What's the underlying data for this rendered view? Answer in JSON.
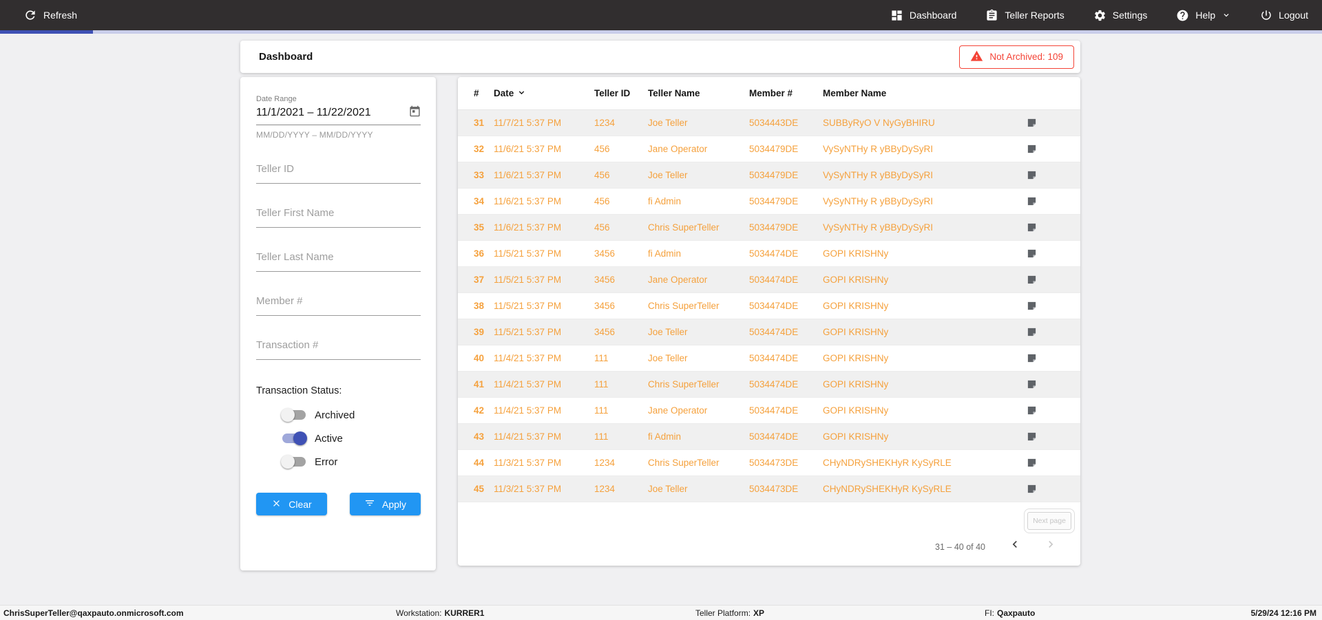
{
  "nav": {
    "refresh_label": "Refresh",
    "items": [
      {
        "label": "Dashboard",
        "icon": "dashboard-grid-icon"
      },
      {
        "label": "Teller Reports",
        "icon": "clipboard-icon"
      },
      {
        "label": "Settings",
        "icon": "gear-icon"
      },
      {
        "label": "Help",
        "icon": "help-circle-icon",
        "has_chevron": true
      },
      {
        "label": "Logout",
        "icon": "power-icon"
      }
    ]
  },
  "header": {
    "title": "Dashboard",
    "not_archived_label": "Not Archived: 109"
  },
  "filters": {
    "date_range": {
      "label": "Date Range",
      "value": "11/1/2021 – 11/22/2021",
      "hint": "MM/DD/YYYY – MM/DD/YYYY",
      "icon": "calendar-icon"
    },
    "inputs": [
      {
        "placeholder": "Teller ID",
        "value": ""
      },
      {
        "placeholder": "Teller First Name",
        "value": ""
      },
      {
        "placeholder": "Teller Last Name",
        "value": ""
      },
      {
        "placeholder": "Member #",
        "value": ""
      },
      {
        "placeholder": "Transaction #",
        "value": ""
      }
    ],
    "status": {
      "label": "Transaction Status:",
      "toggles": [
        {
          "label": "Archived",
          "on": false
        },
        {
          "label": "Active",
          "on": true
        },
        {
          "label": "Error",
          "on": false
        }
      ]
    },
    "clear_label": "Clear",
    "apply_label": "Apply"
  },
  "table": {
    "columns": [
      "#",
      "Date",
      "Teller ID",
      "Teller Name",
      "Member #",
      "Member Name"
    ],
    "sort": {
      "column": "Date",
      "direction": "desc"
    },
    "rows": [
      [
        "31",
        "11/7/21 5:37 PM",
        "1234",
        "Joe Teller",
        "5034443DE",
        "SUBByRyO V NyGyBHIRU"
      ],
      [
        "32",
        "11/6/21 5:37 PM",
        "456",
        "Jane Operator",
        "5034479DE",
        "VySyNTHy R yBByDySyRI"
      ],
      [
        "33",
        "11/6/21 5:37 PM",
        "456",
        "Joe Teller",
        "5034479DE",
        "VySyNTHy R yBByDySyRI"
      ],
      [
        "34",
        "11/6/21 5:37 PM",
        "456",
        "fi Admin",
        "5034479DE",
        "VySyNTHy R yBByDySyRI"
      ],
      [
        "35",
        "11/6/21 5:37 PM",
        "456",
        "Chris SuperTeller",
        "5034479DE",
        "VySyNTHy R yBByDySyRI"
      ],
      [
        "36",
        "11/5/21 5:37 PM",
        "3456",
        "fi Admin",
        "5034474DE",
        "GOPI KRISHNy"
      ],
      [
        "37",
        "11/5/21 5:37 PM",
        "3456",
        "Jane Operator",
        "5034474DE",
        "GOPI KRISHNy"
      ],
      [
        "38",
        "11/5/21 5:37 PM",
        "3456",
        "Chris SuperTeller",
        "5034474DE",
        "GOPI KRISHNy"
      ],
      [
        "39",
        "11/5/21 5:37 PM",
        "3456",
        "Joe Teller",
        "5034474DE",
        "GOPI KRISHNy"
      ],
      [
        "40",
        "11/4/21 5:37 PM",
        "111",
        "Joe Teller",
        "5034474DE",
        "GOPI KRISHNy"
      ],
      [
        "41",
        "11/4/21 5:37 PM",
        "111",
        "Chris SuperTeller",
        "5034474DE",
        "GOPI KRISHNy"
      ],
      [
        "42",
        "11/4/21 5:37 PM",
        "111",
        "Jane Operator",
        "5034474DE",
        "GOPI KRISHNy"
      ],
      [
        "43",
        "11/4/21 5:37 PM",
        "111",
        "fi Admin",
        "5034474DE",
        "GOPI KRISHNy"
      ],
      [
        "44",
        "11/3/21 5:37 PM",
        "1234",
        "Chris SuperTeller",
        "5034473DE",
        "CHyNDRySHEKHyR KySyRLE"
      ],
      [
        "45",
        "11/3/21 5:37 PM",
        "1234",
        "Joe Teller",
        "5034473DE",
        "CHyNDRySHEKHyR KySyRLE"
      ]
    ]
  },
  "pagination": {
    "next_page_label": "Next page",
    "range_label": "31 – 40 of 40"
  },
  "statusbar": {
    "user": "ChrisSuperTeller@qaxpauto.onmicrosoft.com",
    "workstation_label": "Workstation:",
    "workstation_value": "KURRER1",
    "platform_label": "Teller Platform:",
    "platform_value": "XP",
    "fi_label": "FI:",
    "fi_value": "Qaxpauto",
    "datetime": "5/29/24 12:16 PM"
  },
  "colors": {
    "nav-bg": "#312e2f",
    "accent-indigo": "#3f51b5",
    "indigo-track": "#c9cdea",
    "accent-blue": "#2196f3",
    "row-orange": "#f5a13d",
    "alert-red": "#f44336"
  }
}
